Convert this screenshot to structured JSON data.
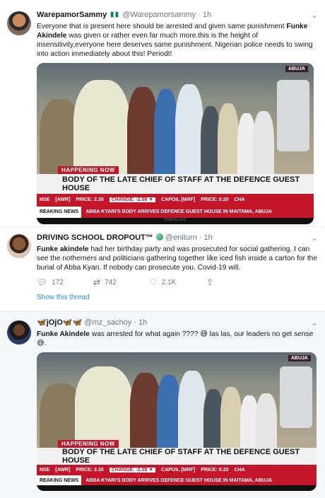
{
  "tweets": [
    {
      "name": "WarepamorSammy",
      "handle": "@Warepamorsammy",
      "time": "1h",
      "text_bold": "",
      "text_pre": "Everyone that is present here should be arrested and given same punishment ",
      "text_bold_mid": "Funke Akindele",
      "text_post": " was given or rather even far much more.this is the height of insensitivity,everyone here deserves same punishment. Nigerian police needs to swing into action immediately about this! Periodt!",
      "media": {
        "location": "ABUJA",
        "badge": "HAPPENING NOW",
        "headline": "BODY OF THE LATE CHIEF OF STAFF AT THE DEFENCE GUEST HOUSE",
        "ticker": [
          "NSE",
          "[AWR]",
          "PRICE: 2.35",
          "CHANGE: -2.08 ▼",
          "CAPOIL [MRF]",
          "PRICE: 0.20",
          "CHA"
        ],
        "breaking_label": "REAKING NEWS",
        "breaking_text": "ABBA KYARI'S BODY ARRIVES DEFENCE GUEST HOUSE IN MAITAMA, ABUJA",
        "brand": "SAMSUNG"
      }
    },
    {
      "name": "DRIVING SCHOOL DROPOUT™",
      "handle": "@eniturn",
      "time": "1h",
      "text_bold": "Funke akindele",
      "text": " had her birthday party and was prosecuted for social gathering. I can see the notherners and politicians gathering together like  iced fish inside a carton for the burial of Abba Kyari. If nobody can prosecute you. Covid-19 will.",
      "replies": "172",
      "retweets": "742",
      "likes": "2.1K",
      "show_thread": "Show this thread"
    },
    {
      "name": "🦋jOjO🦋🦋",
      "handle": "@mz_sachoy",
      "time": "1h",
      "text_bold": "Funke Akindele",
      "text": " was arrested for what again ???? 😅 las las, our leaders no get sense 😅.",
      "media": {
        "location": "ABUJA",
        "badge": "HAPPENING NOW",
        "headline": "BODY OF THE LATE CHIEF OF STAFF AT THE DEFENCE GUEST HOUSE",
        "ticker": [
          "NSE",
          "[AWR]",
          "PRICE: 2.35",
          "CHANGE: -2.08 ▼",
          "CAPOIL [MRF]",
          "PRICE: 0.20",
          "CHA"
        ],
        "breaking_label": "REAKING NEWS",
        "breaking_text": "ABBA KYARI'S BODY ARRIVES DEFENCE GUEST HOUSE IN MAITAMA, ABUJA"
      }
    }
  ],
  "icons": {
    "reply": "reply-icon",
    "retweet": "retweet-icon",
    "like": "heart-icon",
    "share": "share-icon",
    "menu": "chevron-down-icon"
  },
  "colors": {
    "link": "#1b95e0",
    "muted": "#657786",
    "news_red": "#c3162a"
  }
}
